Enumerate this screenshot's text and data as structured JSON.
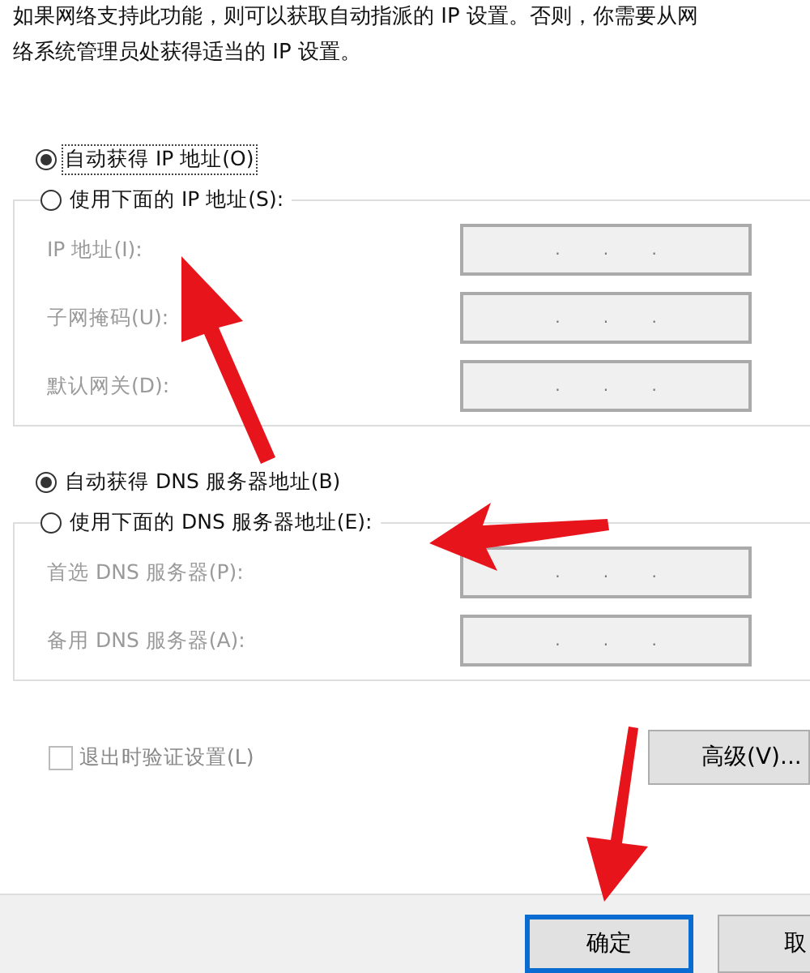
{
  "intro": [
    "如果网络支持此功能，则可以获取自动指派的 IP 设置。否则，你需要从网",
    "络系统管理员处获得适当的 IP 设置。"
  ],
  "ip_mode": [
    {
      "label": "自动获得 IP 地址(O)",
      "selected": true,
      "focused": true
    },
    {
      "label": "使用下面的 IP 地址(S):",
      "selected": false,
      "focused": false
    }
  ],
  "ip_fields": [
    {
      "label": "IP 地址(I):",
      "disabled": true,
      "separators": [
        ".",
        ".",
        "."
      ]
    },
    {
      "label": "子网掩码(U):",
      "disabled": true,
      "separators": [
        ".",
        ".",
        "."
      ]
    },
    {
      "label": "默认网关(D):",
      "disabled": true,
      "separators": [
        ".",
        ".",
        "."
      ]
    }
  ],
  "dns_mode": [
    {
      "label": "自动获得 DNS 服务器地址(B)",
      "selected": true,
      "focused": false
    },
    {
      "label": "使用下面的 DNS 服务器地址(E):",
      "selected": false,
      "focused": false
    }
  ],
  "dns_fields": [
    {
      "label": "首选 DNS 服务器(P):",
      "disabled": true,
      "separators": [
        ".",
        ".",
        "."
      ]
    },
    {
      "label": "备用 DNS 服务器(A):",
      "disabled": true,
      "separators": [
        ".",
        ".",
        "."
      ]
    }
  ],
  "validate": {
    "label": "退出时验证设置(L)",
    "checked": false,
    "disabled": true
  },
  "advanced_button": "高级(V)...",
  "buttons": [
    {
      "label": "确定",
      "default": true
    },
    {
      "label": "取",
      "default": false
    }
  ]
}
